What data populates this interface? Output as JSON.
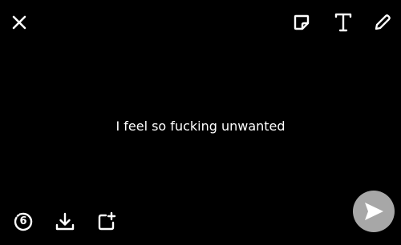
{
  "caption": {
    "text": "I feel so fucking unwanted"
  },
  "timer": {
    "value": "6"
  },
  "icons": {
    "close": "close-icon",
    "sticker": "sticker-icon",
    "text": "text-icon",
    "pencil": "pencil-icon",
    "timer": "timer-icon",
    "save": "download-icon",
    "add_story": "add-to-story-icon",
    "send": "send-arrow-icon"
  },
  "colors": {
    "background": "#000000",
    "foreground": "#ffffff",
    "send_button": "#a7a7a7"
  }
}
